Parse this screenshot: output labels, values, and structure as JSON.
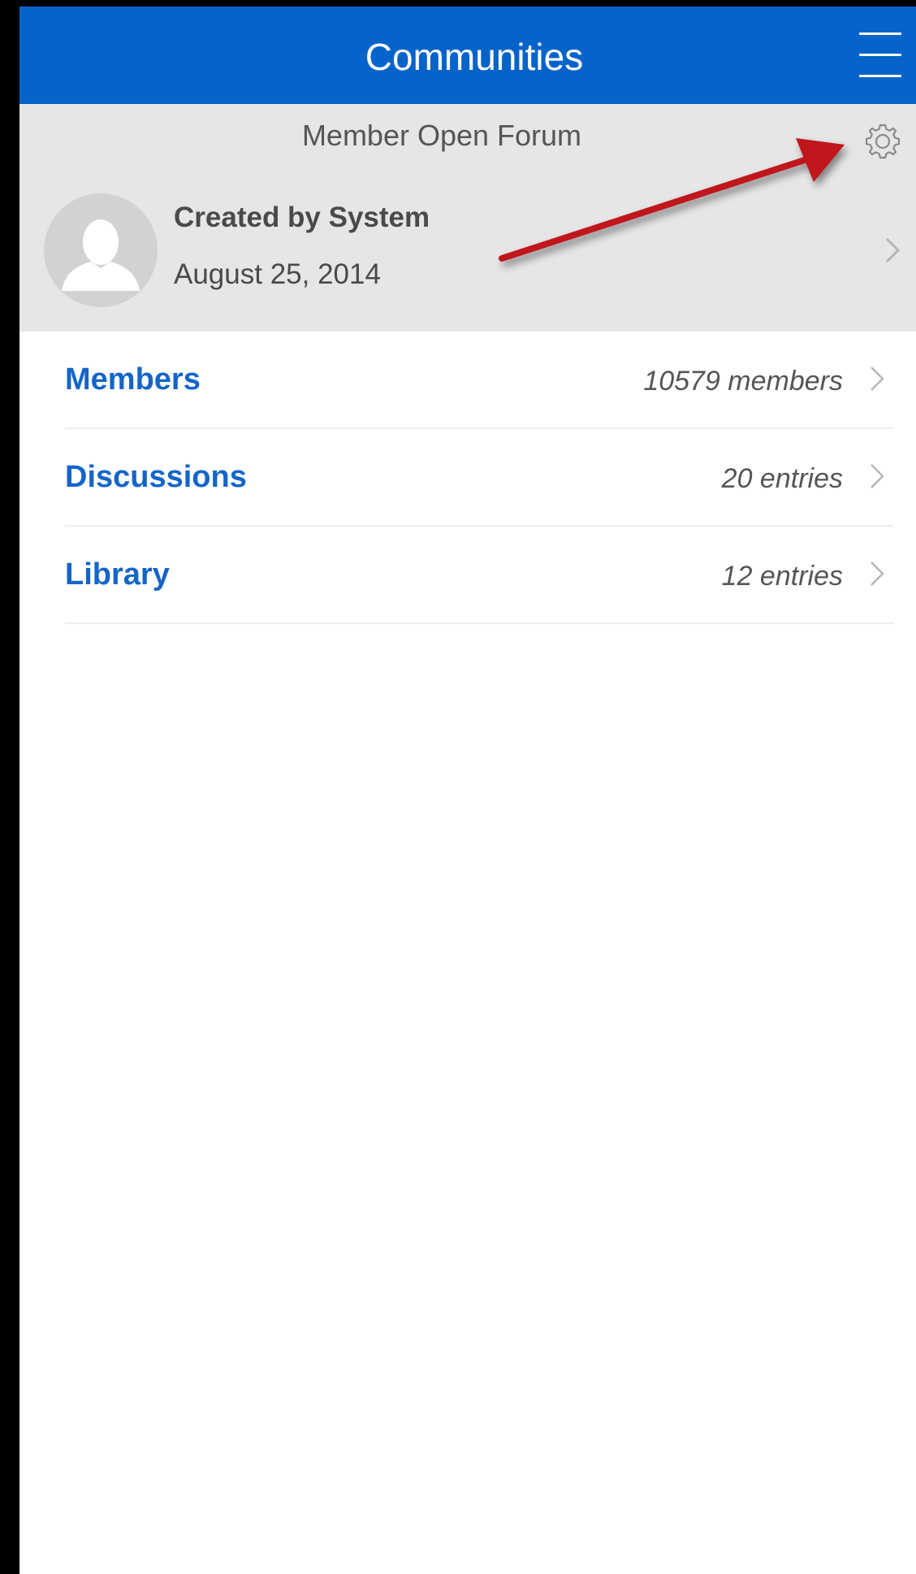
{
  "header": {
    "title": "Communities",
    "menu_icon": "hamburger-menu-icon",
    "color": "#0563c9"
  },
  "community": {
    "name": "Member Open Forum",
    "created_by": "Created by System",
    "created_date": "August 25, 2014",
    "settings_icon": "gear-icon",
    "avatar_icon": "person-placeholder-icon"
  },
  "annotation": {
    "arrow_color": "#c0121b"
  },
  "sections": [
    {
      "label": "Members",
      "count": "10579 members"
    },
    {
      "label": "Discussions",
      "count": "20 entries"
    },
    {
      "label": "Library",
      "count": "12 entries"
    }
  ],
  "colors": {
    "accent": "#1565c8",
    "panel_bg": "#e6e6e6"
  }
}
